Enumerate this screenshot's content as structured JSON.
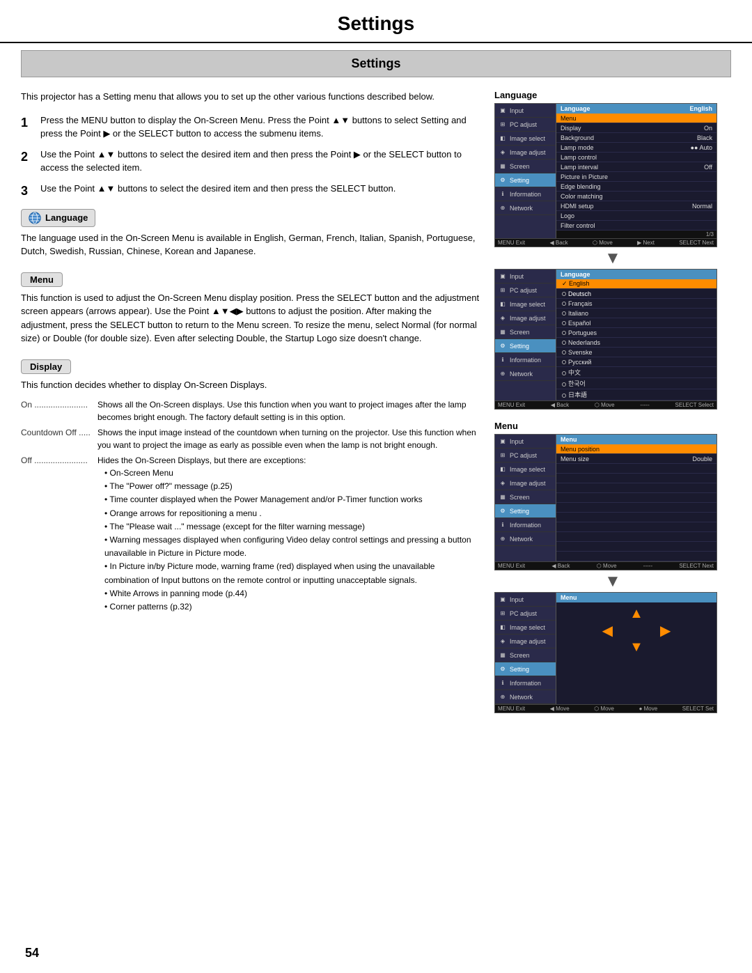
{
  "page": {
    "title": "Settings",
    "section_title": "Settings",
    "page_number": "54"
  },
  "intro": {
    "text": "This projector has a Setting menu that allows you to set up the other various functions described below."
  },
  "steps": [
    {
      "num": "1",
      "text": "Press the MENU button to display the On-Screen Menu.  Press the Point ▲▼ buttons to select Setting and press the Point ▶ or the SELECT button to access the submenu items."
    },
    {
      "num": "2",
      "text": "Use the Point ▲▼ buttons to select the desired item and then press the Point ▶ or the SELECT button to access the selected item."
    },
    {
      "num": "3",
      "text": "Use the Point ▲▼ buttons to select the desired item and then press the SELECT button."
    }
  ],
  "language_section": {
    "label": "Language",
    "text": "The language used in the On-Screen Menu is available in English, German, French, Italian, Spanish, Portuguese, Dutch, Swedish, Russian, Chinese, Korean and Japanese."
  },
  "menu_section": {
    "label": "Menu",
    "text": "This function is used to adjust the On-Screen Menu display position. Press the SELECT button and the adjustment screen appears (arrows appear). Use the Point ▲▼◀▶ buttons to adjust the position. After making the adjustment, press the SELECT button to return to the Menu screen. To resize the menu, select Normal (for normal size) or Double (for double size). Even after selecting Double, the Startup Logo size doesn't change."
  },
  "display_section": {
    "label": "Display",
    "intro": "This function decides whether to display On-Screen Displays.",
    "items": [
      {
        "key": "On .......................",
        "val": "Shows all the On-Screen displays. Use this function when you want to project images after the lamp becomes bright enough. The factory default setting is in this option."
      },
      {
        "key": "Countdown Off .....",
        "val": "Shows the input image instead of the countdown when turning on the projector. Use this function when you want to project the image as early as possible even when the lamp is not bright enough."
      },
      {
        "key": "Off .......................",
        "val": "Hides the On-Screen Displays, but there are exceptions:"
      }
    ],
    "bullets": [
      "On-Screen Menu",
      "The \"Power off?\" message (p.25)",
      "Time counter displayed when the Power Management and/or P-Timer function works",
      "Orange arrows for repositioning a menu .",
      "The \"Please wait ...\" message (except for the filter warning message)",
      "Warning messages displayed when configuring Video delay control settings and pressing a button unavailable in Picture in Picture mode.",
      "In Picture in/by Picture mode, warning frame (red) displayed when using the unavailable combination of Input buttons on the remote control or inputting unacceptable signals.",
      "White Arrows in panning mode (p.44)",
      "Corner patterns (p.32)"
    ]
  },
  "right_column": {
    "language_title": "Language",
    "menu_title": "Menu",
    "nav_items": [
      "Input",
      "PC adjust",
      "Image select",
      "Image adjust",
      "Screen",
      "Setting",
      "Information",
      "Network"
    ],
    "language_panel_header": "Language",
    "language_panel_value": "English",
    "language_menu_rows": [
      "Menu",
      "Display",
      "Background",
      "Lamp mode",
      "Lamp control",
      "Lamp interval",
      "Picture in Picture",
      "Edge blending",
      "Color matching",
      "HDMI setup",
      "Logo",
      "Filter control"
    ],
    "language_menu_values": [
      "",
      "On",
      "Black",
      "Auto",
      "",
      "Off",
      "",
      "",
      "",
      "Normal",
      "",
      ""
    ],
    "language_list": [
      "English",
      "Deutsch",
      "Français",
      "Italiano",
      "Español",
      "Portugues",
      "Nederlands",
      "Svenske",
      "Русский",
      "中文",
      "한국어",
      "日本語"
    ],
    "menu_panel_header": "Menu",
    "menu_position_label": "Menu position",
    "menu_size_label": "Menu size",
    "menu_size_value": "Double",
    "statusbar_exit": "MENU Exit",
    "statusbar_back": "◀ Back",
    "statusbar_move": "⬡ Move",
    "statusbar_next": "▶ Next",
    "statusbar_select": "SELECT Select"
  }
}
